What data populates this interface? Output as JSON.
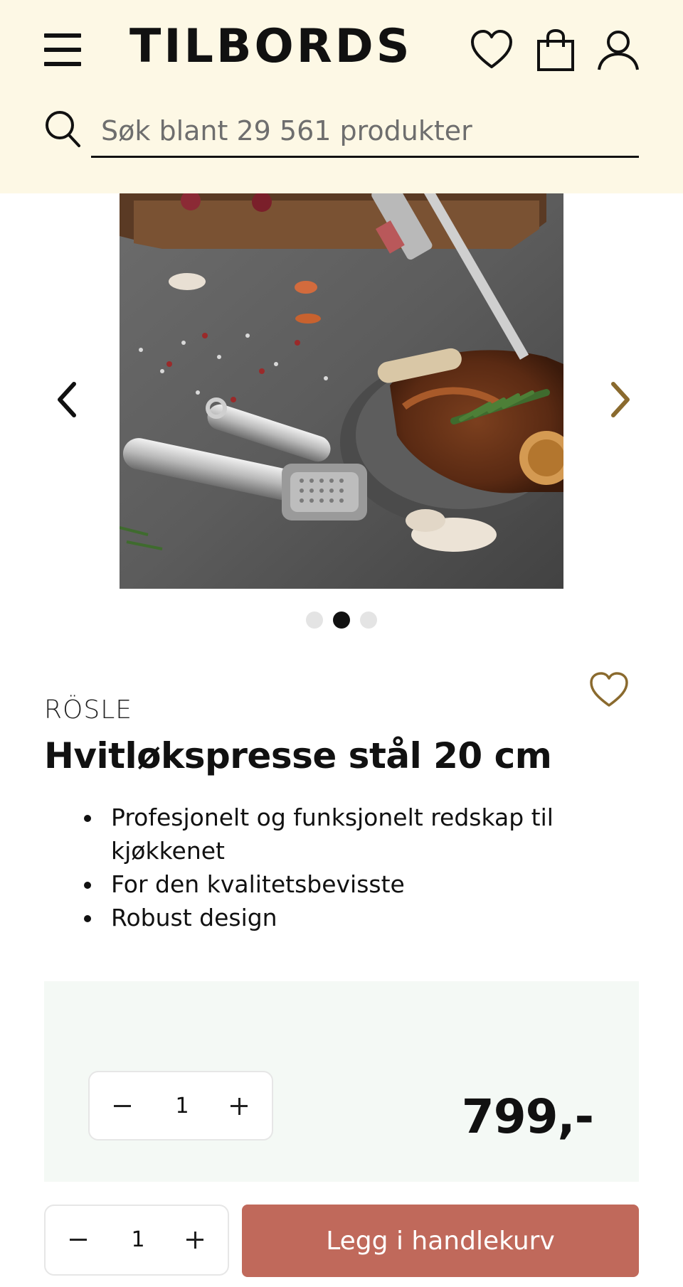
{
  "header": {
    "logo": "TILBORDS",
    "search": {
      "placeholder": "Søk blant 29 561 produkter",
      "value": ""
    }
  },
  "carousel": {
    "image_alt": "Hvitløkspresse stål 20 cm",
    "slide_count": 3,
    "active_slide": 2
  },
  "product": {
    "brand": "RÖSLE",
    "title": "Hvitløkspresse stål 20 cm",
    "features": [
      "Profesjonelt og funksjonelt redskap til kjøkkenet",
      "For den kvalitetsbevisste",
      "Robust design"
    ]
  },
  "purchase": {
    "quantity": "1",
    "price": "799,-"
  },
  "bottom_bar": {
    "quantity": "1",
    "add_to_cart_label": "Legg i handlekurv"
  },
  "colors": {
    "header_bg": "#fdf8e5",
    "accent_gold": "#8a6a2e",
    "cta_bg": "#c0695b",
    "price_box_bg": "#f4f9f5"
  },
  "icons": [
    "menu-icon",
    "heart-icon",
    "shopping-bag-icon",
    "user-icon",
    "search-icon",
    "chevron-left-icon",
    "chevron-right-icon",
    "heart-outline-icon",
    "minus-icon",
    "plus-icon"
  ]
}
